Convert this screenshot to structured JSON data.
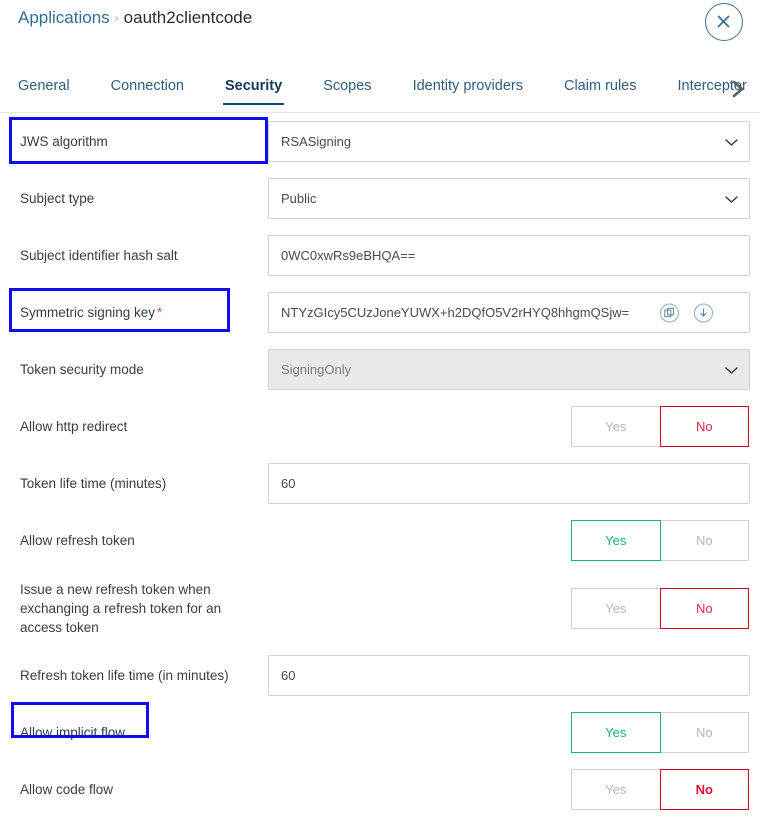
{
  "header": {
    "breadcrumb_root": "Applications",
    "breadcrumb_sep": "›",
    "breadcrumb_current": "oauth2clientcode",
    "close_icon": "close-circle-icon"
  },
  "tabs": {
    "items": [
      {
        "label": "General",
        "active": false
      },
      {
        "label": "Connection",
        "active": false
      },
      {
        "label": "Security",
        "active": true
      },
      {
        "label": "Scopes",
        "active": false
      },
      {
        "label": "Identity providers",
        "active": false
      },
      {
        "label": "Claim rules",
        "active": false
      },
      {
        "label": "Interceptor",
        "active": false
      }
    ],
    "next_icon": "chevron-right-icon"
  },
  "colors": {
    "accent_blue": "#2f6f93",
    "tab_active": "#17446b",
    "highlight": "#0d0df0",
    "yes_green": "#17b27f",
    "no_red": "#cc0020",
    "required_red": "#d9534f"
  },
  "form": {
    "jws_algorithm": {
      "label": "JWS algorithm",
      "value": "RSASigning",
      "highlighted": true
    },
    "subject_type": {
      "label": "Subject type",
      "value": "Public"
    },
    "subject_identifier_hash_salt": {
      "label": "Subject identifier hash salt",
      "value": "0WC0xwRs9eBHQA=="
    },
    "symmetric_signing_key": {
      "label": "Symmetric signing key",
      "required_marker": "*",
      "value": "NTYzGIcy5CUzJoneYUWX+h2DQfO5V2rHYQ8hhgmQSjw=",
      "copy_icon": "copy-icon",
      "download_icon": "download-icon",
      "highlighted": true
    },
    "token_security_mode": {
      "label": "Token security mode",
      "value": "SigningOnly",
      "disabled": true
    },
    "allow_http_redirect": {
      "label": "Allow http redirect",
      "yes_label": "Yes",
      "no_label": "No",
      "selected": "No"
    },
    "token_life_time": {
      "label": "Token life time (minutes)",
      "value": "60"
    },
    "allow_refresh_token": {
      "label": "Allow refresh token",
      "yes_label": "Yes",
      "no_label": "No",
      "selected": "Yes"
    },
    "issue_new_refresh_token": {
      "label": "Issue a new refresh token when exchanging a refresh token for an access token",
      "yes_label": "Yes",
      "no_label": "No",
      "selected": "No"
    },
    "refresh_token_life_time": {
      "label": "Refresh token life time (in minutes)",
      "value": "60"
    },
    "allow_implicit_flow": {
      "label": "Allow implicit flow",
      "yes_label": "Yes",
      "no_label": "No",
      "selected": "Yes",
      "highlighted": true
    },
    "allow_code_flow": {
      "label": "Allow code flow",
      "yes_label": "Yes",
      "no_label": "No",
      "selected": "No"
    }
  }
}
